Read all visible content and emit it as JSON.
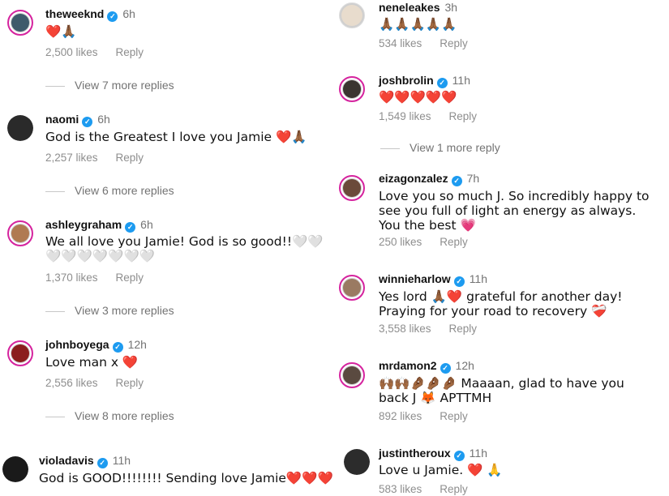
{
  "left": [
    {
      "username": "theweeknd",
      "verified": true,
      "time": "6h",
      "text": "❤️🙏🏾",
      "likes": "2,500 likes",
      "reply": "Reply",
      "more": "View 7 more replies"
    },
    {
      "username": "naomi",
      "verified": true,
      "time": "6h",
      "text": "God is the Greatest I love you Jamie ❤️🙏🏾",
      "likes": "2,257 likes",
      "reply": "Reply",
      "more": "View 6 more replies"
    },
    {
      "username": "ashleygraham",
      "verified": true,
      "time": "6h",
      "text": "We all love you Jamie! God is so good!!🤍🤍🤍🤍🤍🤍🤍🤍🤍",
      "likes": "1,370 likes",
      "reply": "Reply",
      "more": "View 3 more replies"
    },
    {
      "username": "johnboyega",
      "verified": true,
      "time": "12h",
      "text": "Love man x ❤️",
      "likes": "2,556 likes",
      "reply": "Reply",
      "more": "View 8 more replies"
    },
    {
      "username": "violadavis",
      "verified": true,
      "time": "11h",
      "text": "God is GOOD!!!!!!!! Sending love Jamie❤️❤️❤️"
    }
  ],
  "right": [
    {
      "username": "neneleakes",
      "verified": false,
      "time": "3h",
      "text": "🙏🏾🙏🏾🙏🏾🙏🏾🙏🏾",
      "likes": "534 likes",
      "reply": "Reply"
    },
    {
      "username": "joshbrolin",
      "verified": true,
      "time": "11h",
      "text": "❤️❤️❤️❤️❤️",
      "likes": "1,549 likes",
      "reply": "Reply",
      "more": "View 1 more reply"
    },
    {
      "username": "eizagonzalez",
      "verified": true,
      "time": "7h",
      "text": "Love you so much J. So incredibly happy to see you full of light an energy as always. You the best 💗",
      "likes": "250 likes",
      "reply": "Reply"
    },
    {
      "username": "winnieharlow",
      "verified": true,
      "time": "11h",
      "text": "Yes lord 🙏🏾❤️ grateful for another day! Praying for your road to recovery ❤️‍🩹",
      "likes": "3,558 likes",
      "reply": "Reply"
    },
    {
      "username": "mrdamon2",
      "verified": true,
      "time": "12h",
      "text": "🙌🏾🙌🏾🤌🏾🤌🏾🤌🏾 Maaaan, glad to have you back J 🦊 APTTMH",
      "likes": "892 likes",
      "reply": "Reply"
    },
    {
      "username": "justintheroux",
      "verified": true,
      "time": "11h",
      "text": "Love u Jamie. ❤️ 🙏",
      "likes": "583 likes",
      "reply": "Reply"
    }
  ],
  "colors": {
    "verified": "#1d9bf0",
    "story_ring": "#d6249f",
    "muted": "#8e8e8e"
  }
}
